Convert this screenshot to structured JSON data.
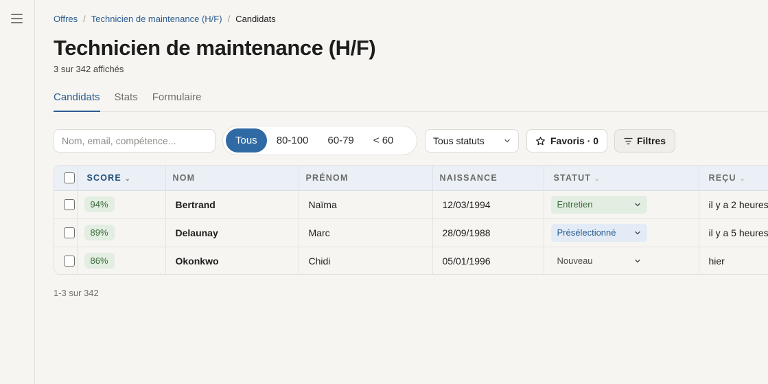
{
  "breadcrumb": {
    "items": [
      {
        "label": "Offres"
      },
      {
        "label": "Technicien de maintenance (H/F)"
      }
    ],
    "separator": "/",
    "current": "Candidats"
  },
  "page": {
    "title": "Technicien de maintenance (H/F)",
    "subtitle": "3 sur 342 affichés"
  },
  "tabs": [
    {
      "label": "Candidats",
      "active": true
    },
    {
      "label": "Stats",
      "active": false
    },
    {
      "label": "Formulaire",
      "active": false
    }
  ],
  "toolbar": {
    "search_placeholder": "Nom, email, compétence...",
    "score_filters": [
      {
        "label": "Tous",
        "active": true
      },
      {
        "label": "80-100",
        "active": false
      },
      {
        "label": "60-79",
        "active": false
      },
      {
        "label": "< 60",
        "active": false
      }
    ],
    "status_select": "Tous statuts",
    "favorites_label": "Favoris · 0",
    "filters_label": "Filtres"
  },
  "table": {
    "columns": {
      "score": "SCORE",
      "nom": "NOM",
      "prenom": "PRÉNOM",
      "naissance": "NAISSANCE",
      "statut": "STATUT",
      "recu": "REÇU"
    },
    "rows": [
      {
        "score": "94%",
        "nom": "Bertrand",
        "prenom": "Naïma",
        "naissance": "12/03/1994",
        "statut": "Entretien",
        "recu": "il y a 2 heures"
      },
      {
        "score": "89%",
        "nom": "Delaunay",
        "prenom": "Marc",
        "naissance": "28/09/1988",
        "statut": "Présélectionné",
        "recu": "il y a 5 heures"
      },
      {
        "score": "86%",
        "nom": "Okonkwo",
        "prenom": "Chidi",
        "naissance": "05/01/1996",
        "statut": "Nouveau",
        "recu": "hier"
      }
    ]
  },
  "pagination": "1-3 sur 342",
  "colors": {
    "accent": "#2f6aa5",
    "link": "#2a5c8f",
    "score_badge_bg": "#e3eee2",
    "status_entretien_bg": "#e3eee2",
    "status_preselectionne_bg": "#e3ecf6"
  }
}
